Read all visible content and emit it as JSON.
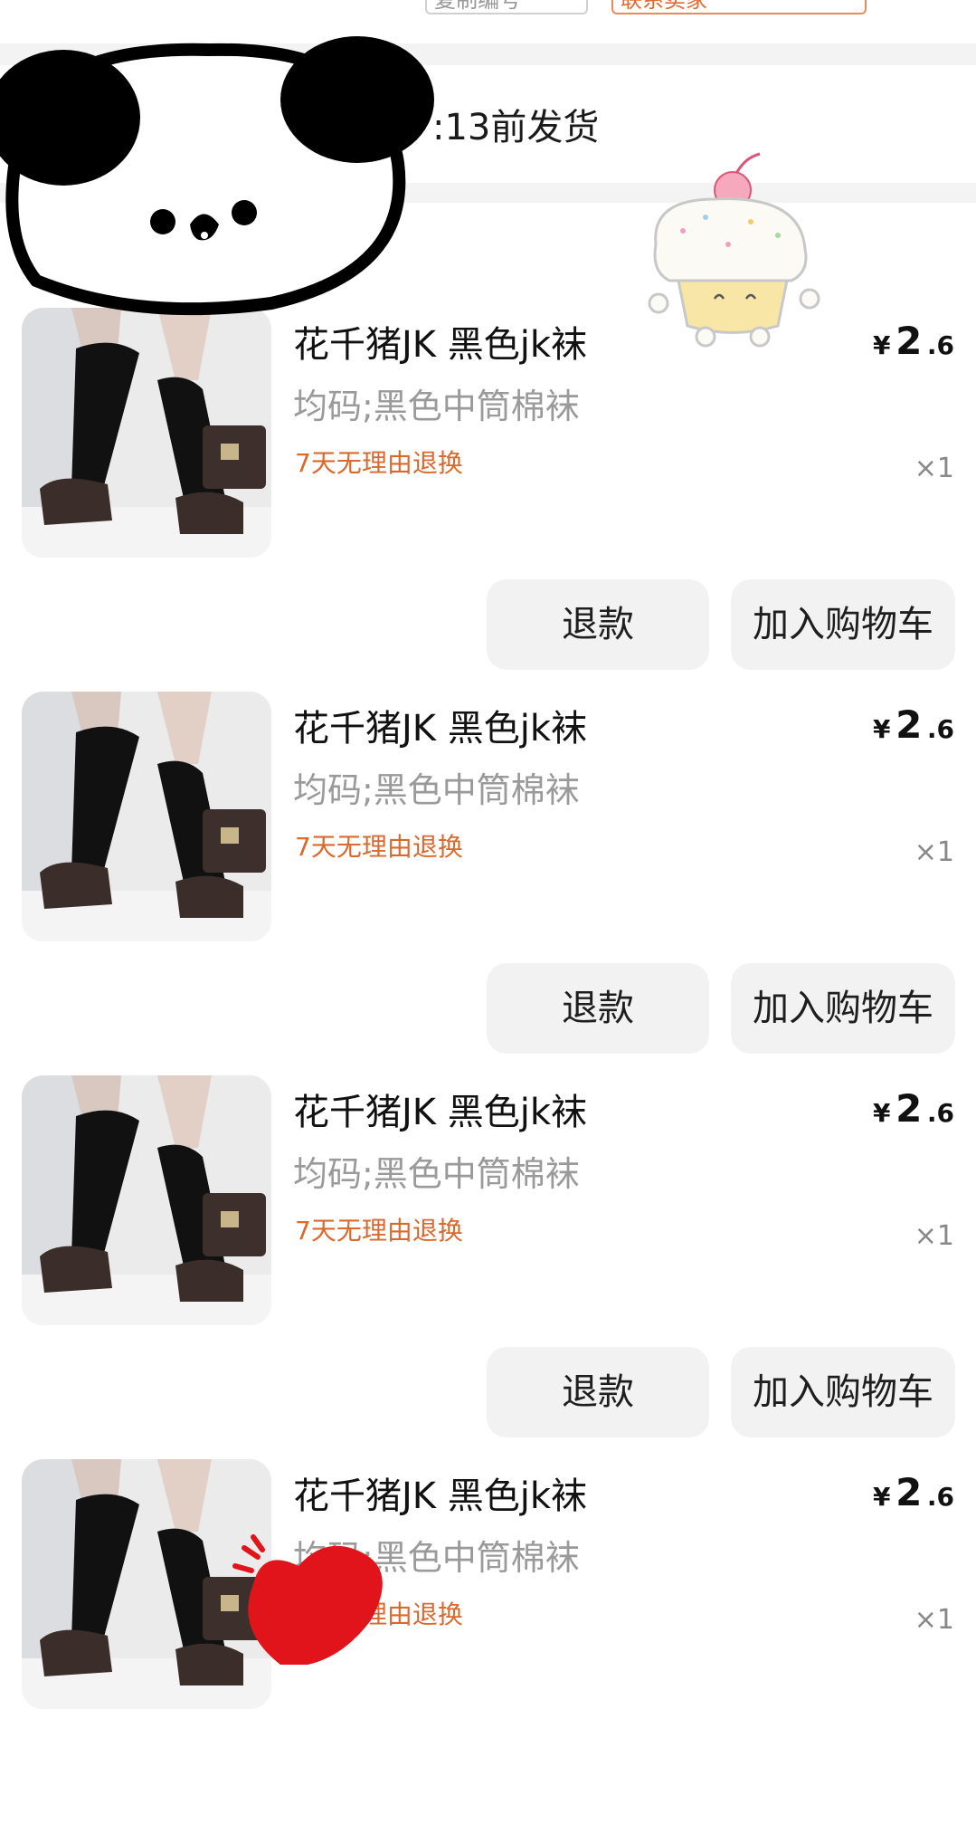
{
  "top_bar": {
    "btn_left_label": "复制编号",
    "btn_right_label": "联系卖家"
  },
  "shipping": {
    "text": ":13前发货"
  },
  "items": [
    {
      "title": "花千猪JK 黑色jk袜",
      "spec": "均码;黑色中筒棉袜",
      "policy": "7天无理由退换",
      "price_currency": "¥",
      "price_int": "2",
      "price_dec": ".6",
      "qty": "×1",
      "refund_label": "退款",
      "cart_label": "加入购物车"
    },
    {
      "title": "花千猪JK 黑色jk袜",
      "spec": "均码;黑色中筒棉袜",
      "policy": "7天无理由退换",
      "price_currency": "¥",
      "price_int": "2",
      "price_dec": ".6",
      "qty": "×1",
      "refund_label": "退款",
      "cart_label": "加入购物车"
    },
    {
      "title": "花千猪JK 黑色jk袜",
      "spec": "均码;黑色中筒棉袜",
      "policy": "7天无理由退换",
      "price_currency": "¥",
      "price_int": "2",
      "price_dec": ".6",
      "qty": "×1",
      "refund_label": "退款",
      "cart_label": "加入购物车"
    },
    {
      "title": "花千猪JK 黑色jk袜",
      "spec": "均码;黑色中筒棉袜",
      "policy": "7天无理由退换",
      "price_currency": "¥",
      "price_int": "2",
      "price_dec": ".6",
      "qty": "×1"
    }
  ],
  "colors": {
    "policy_orange": "#d9692e",
    "button_bg": "#f2f2f2",
    "band_gray": "#f3f3f3",
    "heart_red": "#e0141a"
  }
}
